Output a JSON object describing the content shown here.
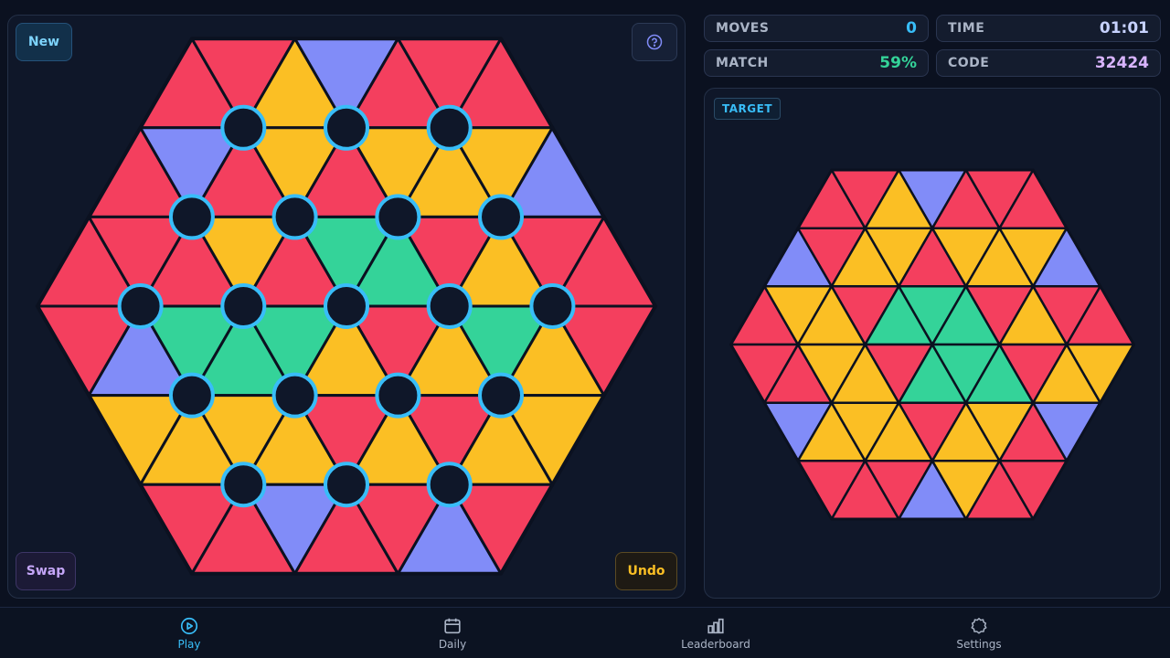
{
  "board": {
    "new_label": "New",
    "swap_label": "Swap",
    "undo_label": "Undo",
    "rows": [
      [
        "red",
        "red",
        "yellow",
        "blue",
        "red",
        "red",
        "red"
      ],
      [
        "red",
        "blue",
        "red",
        "yellow",
        "red",
        "yellow",
        "yellow",
        "yellow",
        "blue"
      ],
      [
        "red",
        "red",
        "red",
        "yellow",
        "red",
        "green",
        "green",
        "red",
        "yellow",
        "red",
        "red"
      ],
      [
        "red",
        "blue",
        "green",
        "green",
        "green",
        "yellow",
        "red",
        "yellow",
        "green",
        "yellow",
        "red"
      ],
      [
        "yellow",
        "yellow",
        "yellow",
        "yellow",
        "red",
        "yellow",
        "red",
        "yellow",
        "yellow"
      ],
      [
        "red",
        "red",
        "blue",
        "red",
        "red",
        "blue",
        "red"
      ]
    ]
  },
  "target": {
    "label": "TARGET",
    "rows": [
      [
        "red",
        "red",
        "yellow",
        "blue",
        "red",
        "red",
        "red"
      ],
      [
        "blue",
        "red",
        "yellow",
        "yellow",
        "red",
        "yellow",
        "yellow",
        "yellow",
        "blue"
      ],
      [
        "red",
        "yellow",
        "yellow",
        "red",
        "green",
        "green",
        "green",
        "red",
        "yellow",
        "red",
        "red"
      ],
      [
        "red",
        "red",
        "yellow",
        "yellow",
        "red",
        "green",
        "green",
        "green",
        "red",
        "yellow",
        "yellow"
      ],
      [
        "blue",
        "yellow",
        "yellow",
        "yellow",
        "red",
        "yellow",
        "yellow",
        "red",
        "blue"
      ],
      [
        "red",
        "red",
        "red",
        "blue",
        "yellow",
        "red",
        "red"
      ]
    ]
  },
  "stats": {
    "moves_label": "MOVES",
    "moves_value": "0",
    "time_label": "TIME",
    "time_value": "01:01",
    "match_label": "MATCH",
    "match_value": "59%",
    "code_label": "CODE",
    "code_value": "32424"
  },
  "nav": [
    {
      "label": "Play",
      "icon": "play-icon",
      "active": true
    },
    {
      "label": "Daily",
      "icon": "calendar-icon",
      "active": false
    },
    {
      "label": "Leaderboard",
      "icon": "bar-chart-icon",
      "active": false
    },
    {
      "label": "Settings",
      "icon": "gear-icon",
      "active": false
    }
  ],
  "colors": {
    "red": "#f43f5e",
    "yellow": "#fbbf24",
    "blue": "#818cf8",
    "green": "#34d399",
    "node_ring": "#38bdf8",
    "node_fill": "#0f1729",
    "accent": "#38bdf8",
    "match": "#34d399",
    "moves": "#38bdf8",
    "time": "#c7d2fe",
    "code": "#d8b4fe"
  }
}
